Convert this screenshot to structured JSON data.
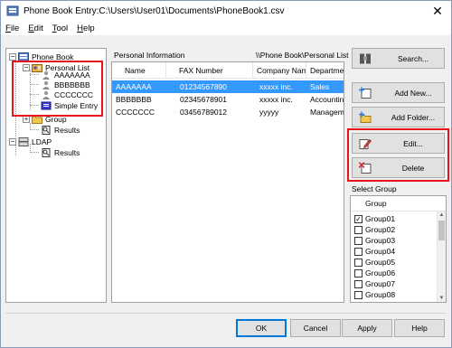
{
  "window": {
    "title": "Phone Book Entry:C:\\Users\\User01\\Documents\\PhoneBook1.csv",
    "close_glyph": "✕"
  },
  "menu": [
    {
      "label": "File"
    },
    {
      "label": "Edit"
    },
    {
      "label": "Tool"
    },
    {
      "label": "Help"
    }
  ],
  "tree": {
    "root": "Phone Book",
    "personal_list": "Personal List",
    "entries": [
      "AAAAAAA",
      "BBBBBBB",
      "CCCCCCC"
    ],
    "simple_entry": "Simple Entry",
    "group": "Group",
    "group_results": "Results",
    "ldap": "LDAP",
    "ldap_results": "Results",
    "expand_glyph": "+",
    "collapse_glyph": "−"
  },
  "list": {
    "label": "Personal Information",
    "path": "\\\\Phone Book\\Personal List",
    "columns": [
      "Name",
      "FAX Number",
      "Company Name",
      "Department"
    ],
    "rows": [
      [
        "AAAAAAA",
        "01234567890",
        "xxxxx inc.",
        "Sales"
      ],
      [
        "BBBBBBB",
        "02345678901",
        "xxxxx inc.",
        "Accounting"
      ],
      [
        "CCCCCCC",
        "03456789012",
        "yyyyy",
        "Management"
      ]
    ],
    "selected_row": 0
  },
  "actions": {
    "search": "Search...",
    "add_new": "Add New...",
    "add_folder": "Add Folder...",
    "edit": "Edit...",
    "delete": "Delete"
  },
  "select_group": {
    "label": "Select Group",
    "header": "Group",
    "items": [
      {
        "label": "Group01",
        "checked": true
      },
      {
        "label": "Group02",
        "checked": false
      },
      {
        "label": "Group03",
        "checked": false
      },
      {
        "label": "Group04",
        "checked": false
      },
      {
        "label": "Group05",
        "checked": false
      },
      {
        "label": "Group06",
        "checked": false
      },
      {
        "label": "Group07",
        "checked": false
      },
      {
        "label": "Group08",
        "checked": false
      }
    ],
    "check_glyph": "✓"
  },
  "footer": {
    "ok": "OK",
    "cancel": "Cancel",
    "apply": "Apply",
    "help": "Help"
  },
  "colors": {
    "highlight": "#e8141b",
    "selection": "#3399ff"
  }
}
